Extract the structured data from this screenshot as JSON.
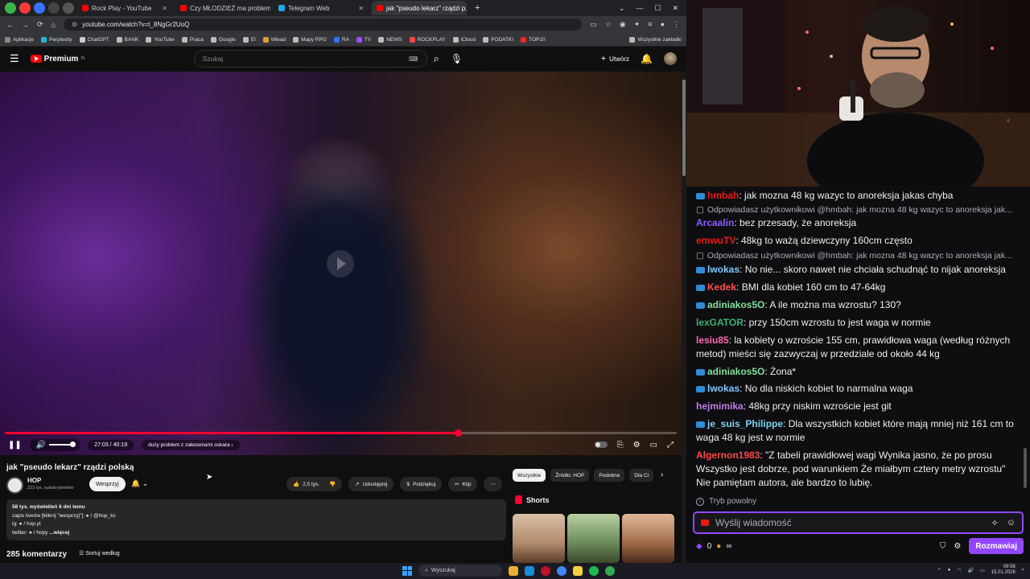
{
  "browser": {
    "tabs": [
      {
        "label": "Rock Play - YouTube",
        "active": false,
        "color": "#ff0000"
      },
      {
        "label": "Czy MŁODZIEŻ ma problem pr...",
        "active": false,
        "color": "#ff0000"
      },
      {
        "label": "Telegram Web",
        "active": false,
        "color": "#2aa3e0"
      },
      {
        "label": "jak \"pseudo lekarz\" rządzi p...",
        "active": true,
        "color": "#ff0000"
      }
    ],
    "url": "youtube.com/watch?v=t_8NgGr2UoQ",
    "bookmarks": [
      "Aplikacje",
      "Perplexity",
      "ChatGPT",
      "BANK",
      "YouTube",
      "Praca",
      "Google",
      "El",
      "Włead",
      "Mapy RPG",
      "RA",
      "TV",
      "NEWS",
      "ROCKPLAY",
      "iCloud",
      "PODATKI",
      "TOP10"
    ],
    "bookmarks_right": "Wszystkie zakładki"
  },
  "yt": {
    "logo": "Premium",
    "logo_sup": "PL",
    "search_placeholder": "Szukaj",
    "create_label": "Utwórz",
    "player": {
      "time": "27:03 / 40:19",
      "chapter": "duży problem z zaleceniami oskara",
      "progress": 0.674
    },
    "title": "jak \"pseudo lekarz\" rządzi polską",
    "channel": "HOP",
    "subs": "223 tys. subskrybentów",
    "support_label": "Wesprzyj",
    "likes": "2,5 tys.",
    "share_label": "Udostępnij",
    "thanks_label": "Podziękuj",
    "clip_label": "Klip",
    "desc": {
      "stats": "58 tys. wyświetleń  6 dni temu",
      "line1": "zapis liveów [kliknij \"wesprzyj\"]: ● / @hop_ks",
      "line2": "ig: ● / hop.yt",
      "line3": "twitter: ● / hopy",
      "more": "...więcej"
    },
    "comments": "285 komentarzy",
    "sort_label": "Sortuj według",
    "chips": [
      "Wszystkie",
      "Źródło: HOP",
      "Podobne",
      "Dla Ci"
    ],
    "shorts_label": "Shorts"
  },
  "chat": {
    "messages": [
      {
        "type": "msg",
        "user": "hmbah",
        "color": "#e91916",
        "text": ": jak mozna 48 kg wazyc to anoreksja jakas chyba",
        "badge": true
      },
      {
        "type": "reply",
        "text": "Odpowiadasz użytkownikowi @hmbah: jak mozna 48 kg wazyc to anoreksja jak..."
      },
      {
        "type": "msg",
        "user": "Arcaalin",
        "color": "#8a5cf6",
        "text": ": bez przesady, że anoreksja",
        "badge": false
      },
      {
        "type": "msg",
        "user": "emwuTV",
        "color": "#e91916",
        "text": ": 48kg to ważą dziewczyny 160cm często",
        "badge": false
      },
      {
        "type": "reply",
        "text": "Odpowiadasz użytkownikowi @hmbah: jak mozna 48 kg wazyc to anoreksja jak..."
      },
      {
        "type": "msg",
        "user": "lwokas",
        "color": "#7ec8ff",
        "text": ": No nie... skoro nawet nie chciała schudnąć to nijak anoreksja",
        "badge": true
      },
      {
        "type": "msg",
        "user": "Kedek",
        "color": "#ff4d4d",
        "text": ": BMI dla kobiet 160 cm to 47-64kg",
        "badge": true
      },
      {
        "type": "msg",
        "user": "adiniakos5O",
        "color": "#7fe09a",
        "text": ": A ile można ma wzrostu? 130?",
        "badge": true
      },
      {
        "type": "msg",
        "user": "lexGATOR",
        "color": "#3cb371",
        "text": ": przy 150cm wzrostu to jest waga w normie",
        "badge": false
      },
      {
        "type": "msg",
        "user": "lesiu85",
        "color": "#ff69b4",
        "text": ": la kobiety o wzroście 155 cm, prawidłowa waga (według różnych metod) mieści się zazwyczaj w przedziale od około 44 kg",
        "badge": false
      },
      {
        "type": "msg",
        "user": "adiniakos5O",
        "color": "#7fe09a",
        "text": ": Żona*",
        "badge": true
      },
      {
        "type": "msg",
        "user": "lwokas",
        "color": "#7ec8ff",
        "text": ": No dla niskich kobiet to narmalna waga",
        "badge": true
      },
      {
        "type": "msg",
        "user": "hejmimika",
        "color": "#c07ae8",
        "text": ": 48kg przy niskim wzroście jest git",
        "badge": false
      },
      {
        "type": "msg",
        "user": "je_suis_Philippe",
        "color": "#7ed3f0",
        "text": ": Dla wszystkich kobiet które mają mniej niż 161 cm to waga 48 kg jest w normie",
        "badge": true
      },
      {
        "type": "msg",
        "user": "Algernon1983",
        "color": "#ff4545",
        "text": ": \"Z tabeli prawidłowej wagi Wynika jasno, że po prosu Wszystko jest dobrze, pod warunkiem Że miałbym cztery metry wzrostu\" Nie pamiętam autora, ale bardzo to lubię.",
        "badge": false
      }
    ],
    "slow_mode": "Tryb powolny",
    "input_placeholder": "Wyślij wiadomość",
    "points": "0",
    "points_extra": "∞",
    "send_label": "Rozmawiaj"
  },
  "taskbar": {
    "search_label": "Wyszukaj",
    "time": "09:56",
    "date": "15.01.2026"
  }
}
